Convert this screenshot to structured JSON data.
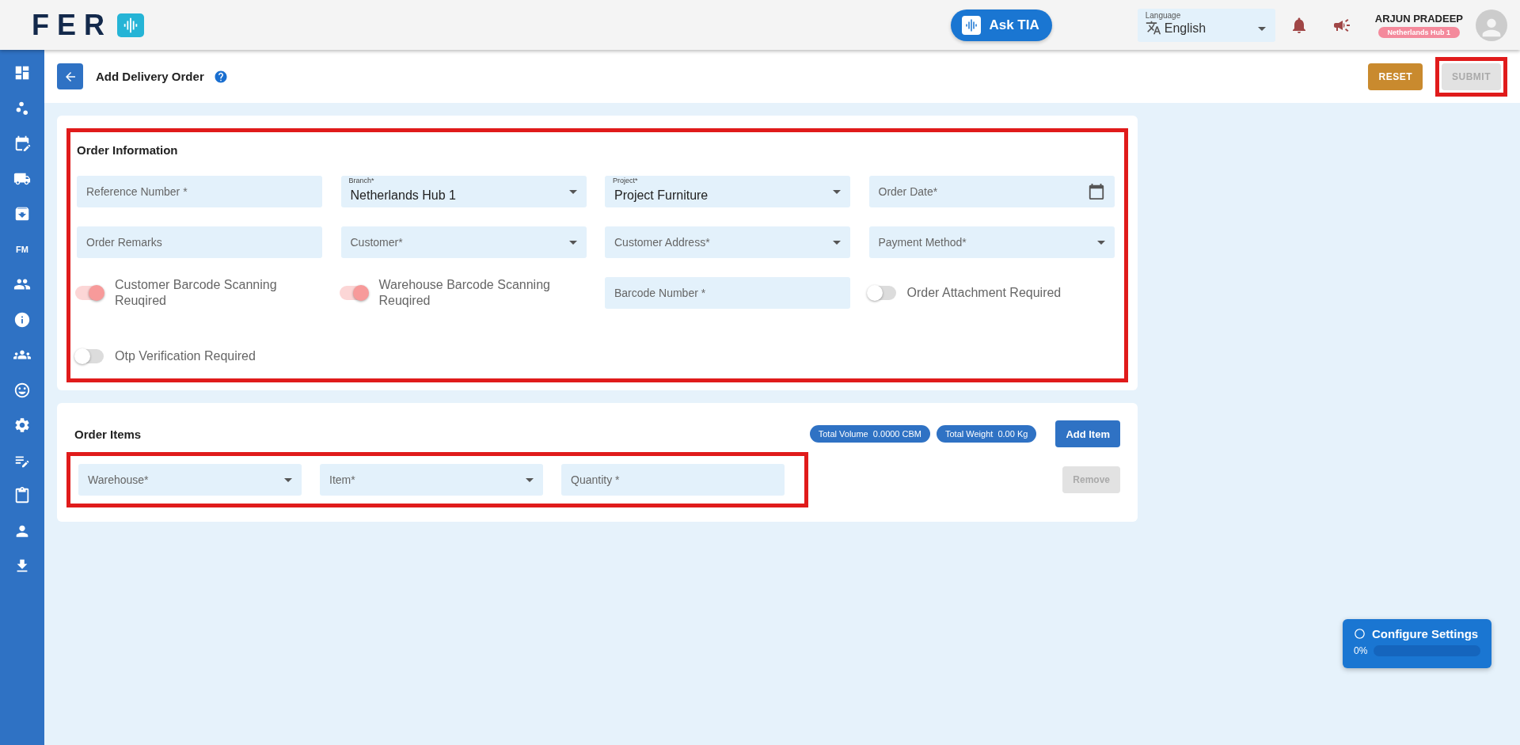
{
  "brand": {
    "name": "FER"
  },
  "topbar": {
    "ask_button": "Ask TIA",
    "language": {
      "label": "Language",
      "value": "English"
    },
    "user": {
      "name": "ARJUN PRADEEP",
      "branch": "Netherlands Hub 1"
    }
  },
  "sidebar": {
    "items": [
      {
        "kind": "icon"
      },
      {
        "kind": "icon"
      },
      {
        "kind": "icon"
      },
      {
        "kind": "icon"
      },
      {
        "kind": "icon"
      },
      {
        "kind": "text",
        "label": "FM"
      },
      {
        "kind": "icon"
      },
      {
        "kind": "icon"
      },
      {
        "kind": "icon"
      },
      {
        "kind": "icon"
      },
      {
        "kind": "icon"
      },
      {
        "kind": "icon"
      },
      {
        "kind": "icon"
      },
      {
        "kind": "icon"
      },
      {
        "kind": "icon"
      }
    ]
  },
  "page": {
    "title": "Add Delivery Order",
    "buttons": [
      {
        "kind": "reset",
        "label": "RESET",
        "disabled": false,
        "highlighted": false
      },
      {
        "kind": "submit",
        "label": "SUBMIT",
        "disabled": true,
        "highlighted": true
      }
    ]
  },
  "order_information": {
    "title": "Order Information",
    "highlighted": true,
    "fields": [
      {
        "kind": "text",
        "placeholder": "Reference Number *"
      },
      {
        "kind": "select",
        "label": "Branch*",
        "value": "Netherlands Hub 1"
      },
      {
        "kind": "select",
        "label": "Project*",
        "value": "Project Furniture"
      },
      {
        "kind": "date",
        "placeholder": "Order Date*"
      },
      {
        "kind": "text",
        "placeholder": "Order Remarks"
      },
      {
        "kind": "select",
        "placeholder": "Customer*"
      },
      {
        "kind": "select",
        "placeholder": "Customer Address*"
      },
      {
        "kind": "select",
        "placeholder": "Payment Method*"
      },
      {
        "kind": "toggle",
        "label": "Customer Barcode Scanning Reuqired",
        "on": true
      },
      {
        "kind": "toggle",
        "label": "Warehouse Barcode Scanning Reuqired",
        "on": true
      },
      {
        "kind": "text",
        "placeholder": "Barcode Number *"
      },
      {
        "kind": "toggle",
        "label": "Order Attachment Required",
        "on": false
      },
      {
        "kind": "toggle",
        "label": "Otp Verification Required",
        "on": false
      }
    ]
  },
  "order_items": {
    "title": "Order Items",
    "totals": [
      {
        "label": "Total Volume",
        "value": "0.0000 CBM"
      },
      {
        "label": "Total Weight",
        "value": "0.00 Kg"
      }
    ],
    "add_button": "Add Item",
    "highlighted": true,
    "rows": [
      {
        "fields": [
          {
            "kind": "select",
            "placeholder": "Warehouse*"
          },
          {
            "kind": "select",
            "placeholder": "Item*"
          },
          {
            "kind": "text",
            "placeholder": "Quantity *"
          }
        ],
        "remove_button": {
          "label": "Remove",
          "disabled": true
        }
      }
    ]
  },
  "configure": {
    "title": "Configure Settings",
    "percent": "0%",
    "level": 0
  }
}
